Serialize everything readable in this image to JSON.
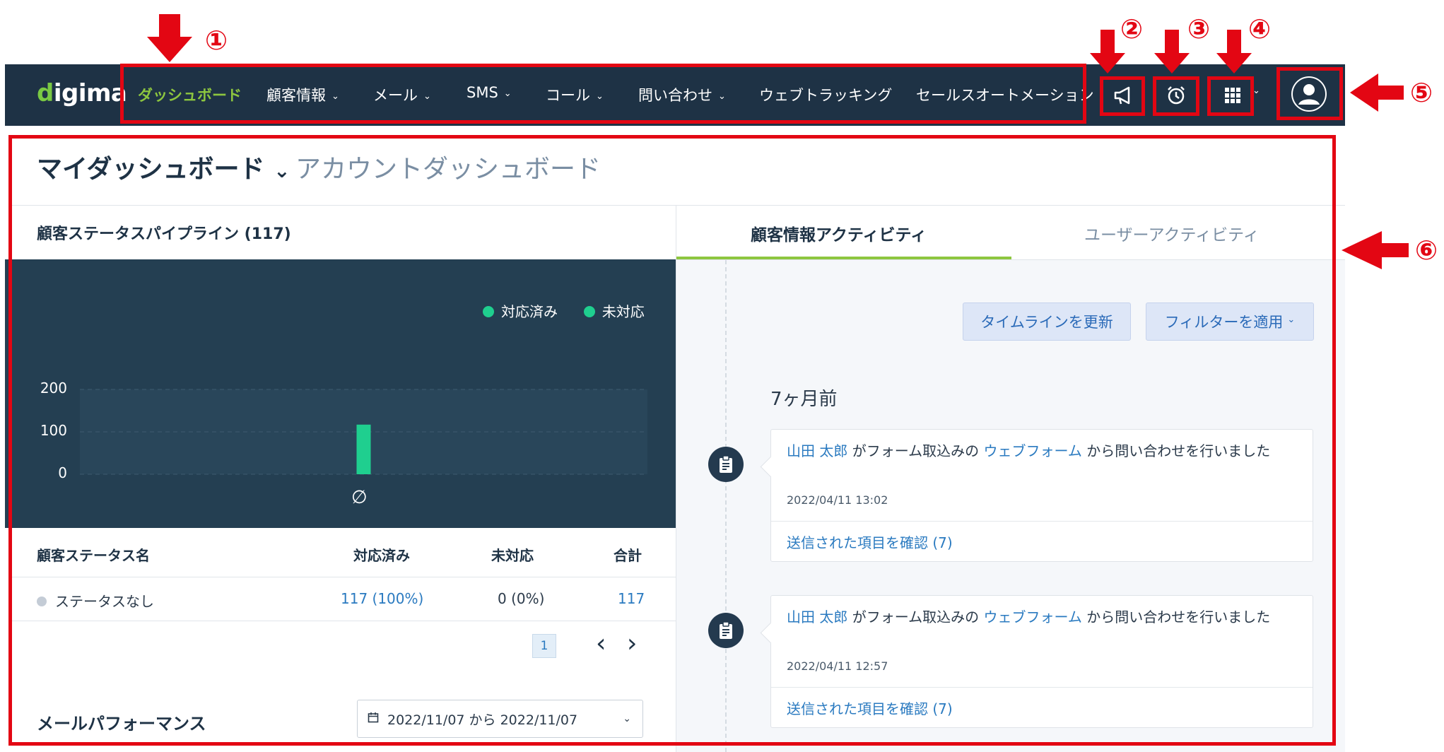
{
  "annotations": [
    "①",
    "②",
    "③",
    "④",
    "⑤",
    "⑥"
  ],
  "nav": {
    "logo": "digima",
    "items": [
      {
        "label": "ダッシュボード",
        "dropdown": false,
        "active": true
      },
      {
        "label": "顧客情報",
        "dropdown": true
      },
      {
        "label": "メール",
        "dropdown": true
      },
      {
        "label": "SMS",
        "dropdown": true
      },
      {
        "label": "コール",
        "dropdown": true
      },
      {
        "label": "問い合わせ",
        "dropdown": true
      },
      {
        "label": "ウェブトラッキング",
        "dropdown": false
      },
      {
        "label": "セールスオートメーション",
        "dropdown": false
      }
    ],
    "icons": [
      "megaphone-icon",
      "alarm-clock-icon",
      "apps-grid-icon",
      "user-avatar-icon"
    ]
  },
  "header": {
    "title": "マイダッシュボード",
    "subtitle": "アカウントダッシュボード"
  },
  "pipeline": {
    "title": "顧客ステータスパイプライン (117)",
    "legend": [
      "対応済み",
      "未対応"
    ],
    "colors": {
      "done": "#1fcf8f",
      "accent": "#8dc63f",
      "red": "#e30613"
    },
    "table": {
      "headers": [
        "顧客ステータス名",
        "対応済み",
        "未対応",
        "合計"
      ],
      "rows": [
        {
          "name": "ステータスなし",
          "done": "117 (100%)",
          "pending": "0 (0%)",
          "total": "117"
        }
      ]
    },
    "pagination": {
      "page": "1",
      "prev": "‹",
      "next": "›"
    }
  },
  "chart_data": {
    "type": "bar",
    "categories": [
      "∅"
    ],
    "series": [
      {
        "name": "対応済み",
        "values": [
          117
        ]
      },
      {
        "name": "未対応",
        "values": [
          0
        ]
      }
    ],
    "yticks": [
      0,
      100,
      200
    ],
    "ylim": [
      0,
      200
    ],
    "legend_position": "top-right"
  },
  "mail_perf": {
    "title": "メールパフォーマンス",
    "date_range": "2022/11/07 から 2022/11/07"
  },
  "activity": {
    "tabs": [
      "顧客情報アクティビティ",
      "ユーザーアクティビティ"
    ],
    "buttons": {
      "refresh": "タイムラインを更新",
      "filter": "フィルターを適用"
    },
    "period": "7ヶ月前",
    "items": [
      {
        "user": "山田 太郎",
        "text1": " がフォーム取込みの ",
        "form": "ウェブフォーム",
        "text2": " から問い合わせを行いました",
        "time": "2022/04/11 13:02",
        "link": "送信された項目を確認 (7)"
      },
      {
        "user": "山田 太郎",
        "text1": " がフォーム取込みの ",
        "form": "ウェブフォーム",
        "text2": " から問い合わせを行いました",
        "time": "2022/04/11 12:57",
        "link": "送信された項目を確認 (7)"
      }
    ]
  }
}
